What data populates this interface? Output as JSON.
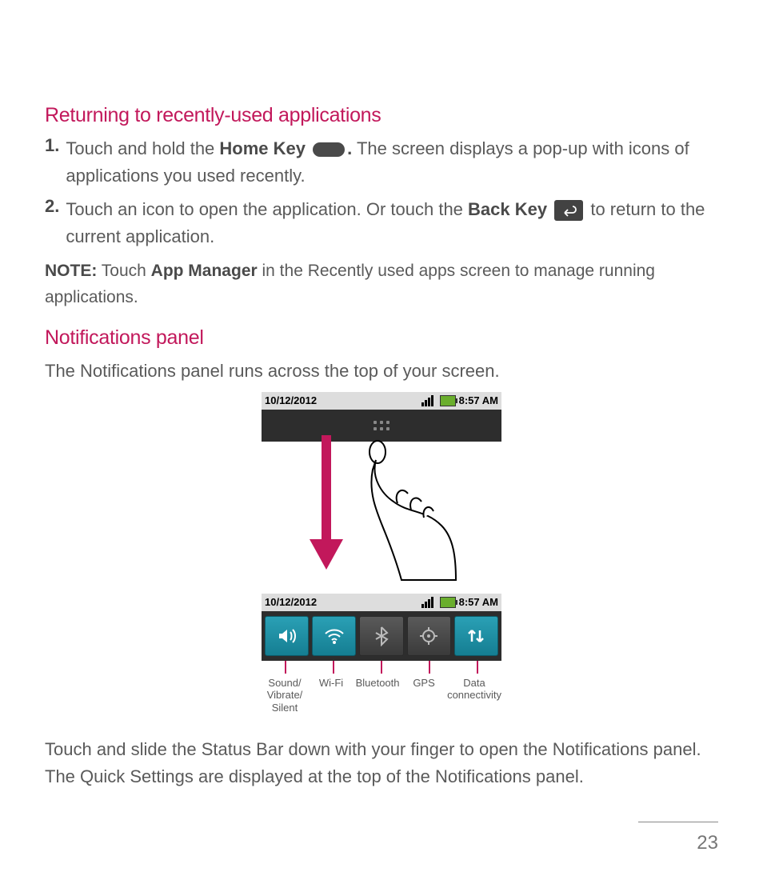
{
  "sections": {
    "returning_title": "Returning to recently-used applications",
    "step1_num": "1.",
    "step1_a": "Touch and hold the ",
    "step1_bold": "Home Key ",
    "step1_b": " The screen displays a pop-up with icons of applications you used recently.",
    "step1_period": ".",
    "step2_num": "2.",
    "step2_a": "Touch an icon to open the application. Or touch the ",
    "step2_bold": "Back Key ",
    "step2_b": " to return to the current application.",
    "note_label": "NOTE:",
    "note_a": " Touch ",
    "note_bold": "App Manager",
    "note_b": " in the Recently used apps screen to manage running applications.",
    "notif_title": "Notifications panel",
    "notif_intro": "The Notifications panel runs across the top of your screen.",
    "notif_outro": "Touch and slide the Status Bar down with your finger to open the Notifications panel. The Quick Settings are displayed at the top of the Notifications panel."
  },
  "statusbar": {
    "date": "10/12/2012",
    "time": "8:57 AM"
  },
  "quick_labels": {
    "sound": "Sound/\nVibrate/\nSilent",
    "wifi": "Wi-Fi",
    "bt": "Bluetooth",
    "gps": "GPS",
    "data": "Data\nconnectivity"
  },
  "page_number": "23"
}
